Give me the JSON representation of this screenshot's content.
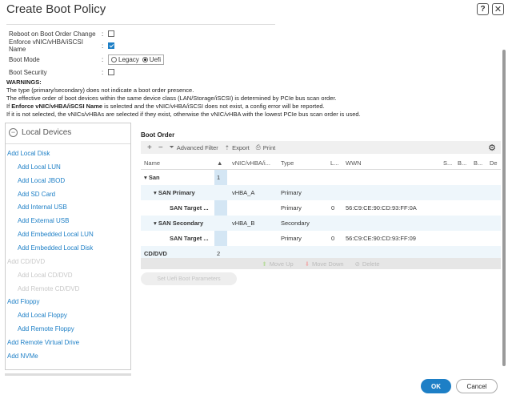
{
  "dialog": {
    "title": "Create Boot Policy",
    "help_glyph": "?",
    "close_glyph": "✕"
  },
  "form": {
    "reboot_label": "Reboot on Boot Order Change",
    "reboot_checked": false,
    "enforce_label": "Enforce vNIC/vHBA/iSCSI Name",
    "enforce_checked": true,
    "boot_mode_label": "Boot Mode",
    "boot_mode_options": [
      "Legacy",
      "Uefi"
    ],
    "boot_mode_selected": "Uefi",
    "boot_security_label": "Boot Security",
    "boot_security_checked": false,
    "colon": ":"
  },
  "warnings": {
    "heading": "WARNINGS:",
    "line1": "The type (primary/secondary) does not indicate a boot order presence.",
    "line2": "The effective order of boot devices within the same device class (LAN/Storage/iSCSI) is determined by PCIe bus scan order.",
    "line3_bold": "Enforce vNIC/vHBA/iSCSI Name",
    "line3_pre": "If ",
    "line3_post": " is selected and the vNIC/vHBA/iSCSI does not exist, a config error will be reported.",
    "line4": "If it is not selected, the vNICs/vHBAs are selected if they exist, otherwise the vNIC/vHBA with the lowest PCIe bus scan order is used."
  },
  "local_devices": {
    "header": "Local Devices",
    "items": [
      {
        "label": "Add Local Disk",
        "level": 1,
        "enabled": true
      },
      {
        "label": "Add Local LUN",
        "level": 2,
        "enabled": true
      },
      {
        "label": "Add Local JBOD",
        "level": 2,
        "enabled": true
      },
      {
        "label": "Add SD Card",
        "level": 2,
        "enabled": true
      },
      {
        "label": "Add Internal USB",
        "level": 2,
        "enabled": true
      },
      {
        "label": "Add External USB",
        "level": 2,
        "enabled": true
      },
      {
        "label": "Add Embedded Local LUN",
        "level": 2,
        "enabled": true
      },
      {
        "label": "Add Embedded Local Disk",
        "level": 2,
        "enabled": true
      },
      {
        "label": "Add CD/DVD",
        "level": 1,
        "enabled": false
      },
      {
        "label": "Add Local CD/DVD",
        "level": 2,
        "enabled": false
      },
      {
        "label": "Add Remote CD/DVD",
        "level": 2,
        "enabled": false
      },
      {
        "label": "Add Floppy",
        "level": 1,
        "enabled": true
      },
      {
        "label": "Add Local Floppy",
        "level": 2,
        "enabled": true
      },
      {
        "label": "Add Remote Floppy",
        "level": 2,
        "enabled": true
      },
      {
        "label": "Add Remote Virtual Drive",
        "level": 1,
        "enabled": true
      },
      {
        "label": "Add NVMe",
        "level": 1,
        "enabled": true
      }
    ]
  },
  "boot_order": {
    "title": "Boot Order",
    "toolbar": {
      "add": "+",
      "remove": "−",
      "advanced_filter": "Advanced Filter",
      "export": "Export",
      "print": "Print"
    },
    "columns": [
      "Name",
      "▲",
      "vNIC/vHBA/i...",
      "Type",
      "L...",
      "WWN",
      "S...",
      "B...",
      "B...",
      "De"
    ],
    "rows": [
      {
        "name": "San",
        "order": "1",
        "vnic": "",
        "type": "",
        "lun": "",
        "wwn": "",
        "indent": 0,
        "expand": true
      },
      {
        "name": "SAN Primary",
        "order": "",
        "vnic": "vHBA_A",
        "type": "Primary",
        "lun": "",
        "wwn": "",
        "indent": 1,
        "expand": true
      },
      {
        "name": "SAN Target ...",
        "order": "",
        "vnic": "",
        "type": "Primary",
        "lun": "0",
        "wwn": "56:C9:CE:90:CD:93:FF:0A",
        "indent": 2,
        "expand": false
      },
      {
        "name": "SAN Secondary",
        "order": "",
        "vnic": "vHBA_B",
        "type": "Secondary",
        "lun": "",
        "wwn": "",
        "indent": 1,
        "expand": true
      },
      {
        "name": "SAN Target ...",
        "order": "",
        "vnic": "",
        "type": "Primary",
        "lun": "0",
        "wwn": "56:C9:CE:90:CD:93:FF:09",
        "indent": 2,
        "expand": false
      },
      {
        "name": "CD/DVD",
        "order": "2",
        "vnic": "",
        "type": "",
        "lun": "",
        "wwn": "",
        "indent": 0,
        "expand": false
      }
    ],
    "move_up": "Move Up",
    "move_down": "Move Down",
    "delete": "Delete",
    "set_uefi": "Set Uefi Boot Parameters"
  },
  "buttons": {
    "ok": "OK",
    "cancel": "Cancel"
  },
  "colors": {
    "accent": "#1d7fc6",
    "disabled_text": "#c8c8c8",
    "selected_column": "#d4e6f4"
  }
}
